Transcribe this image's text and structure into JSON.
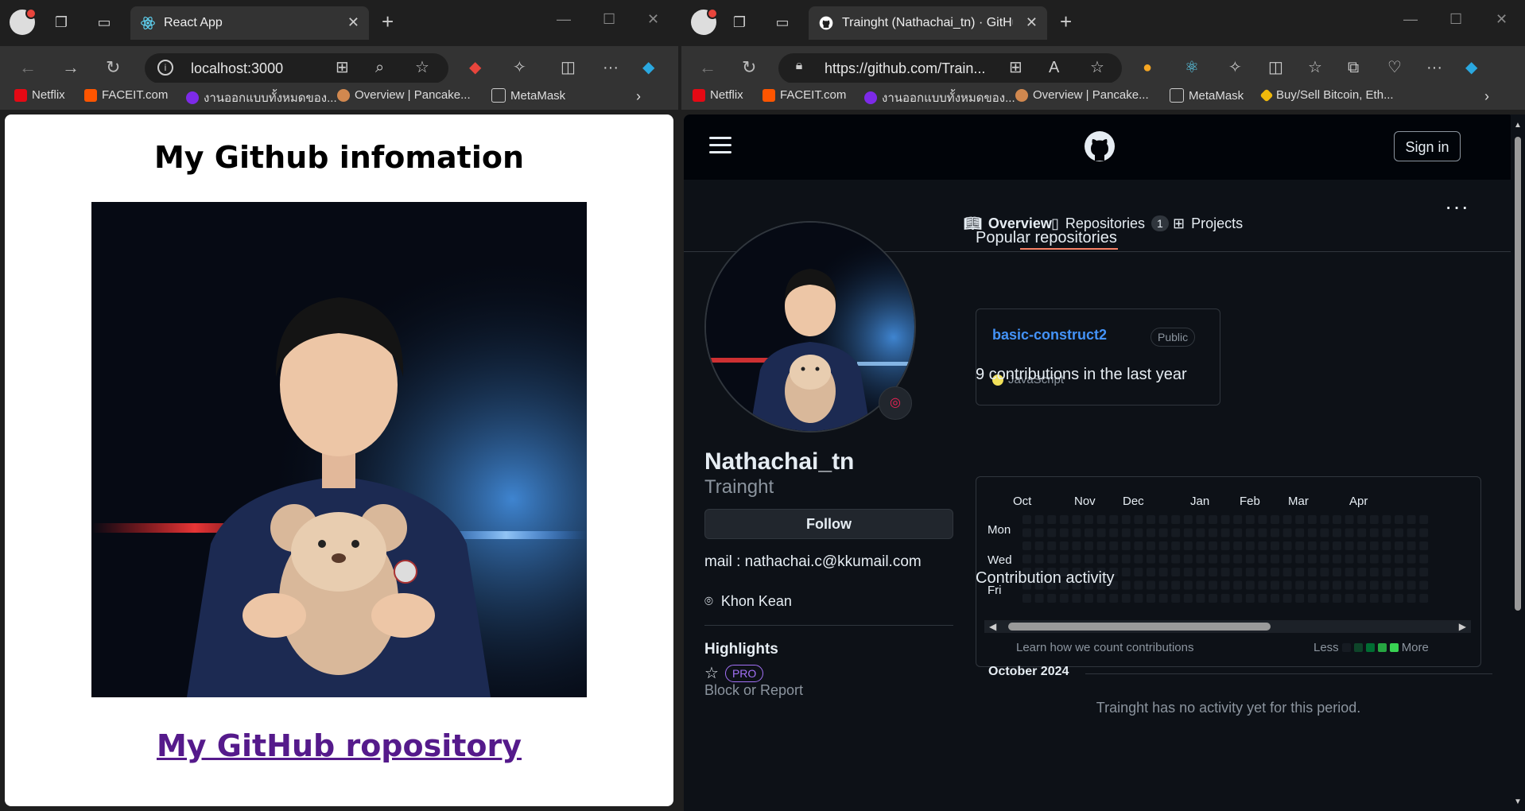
{
  "left_browser": {
    "tab_title": "React App",
    "address": "localhost:3000",
    "bookmarks": [
      "Netflix",
      "FACEIT.com",
      "งานออกแบบทั้งหมดของ...",
      "Overview | Pancake...",
      "MetaMask"
    ]
  },
  "left_page": {
    "title": "My Github infomation",
    "link_text": "My GitHub ropository"
  },
  "right_browser": {
    "tab_title": "Trainght (Nathachai_tn) · GitHub",
    "address": "https://github.com/Train...",
    "bookmarks": [
      "Netflix",
      "FACEIT.com",
      "งานออกแบบทั้งหมดของ...",
      "Overview | Pancake...",
      "MetaMask",
      "Buy/Sell Bitcoin, Eth..."
    ]
  },
  "github": {
    "sign_in": "Sign in",
    "tabs": [
      {
        "label": "Overview"
      },
      {
        "label": "Repositories",
        "count": "1"
      },
      {
        "label": "Projects"
      }
    ],
    "more": "···",
    "profile": {
      "name": "Nathachai_tn",
      "login": "Trainght",
      "follow": "Follow",
      "bio": "mail : nathachai.c@kkumail.com",
      "location": "Khon Kean",
      "highlights_title": "Highlights",
      "pro_badge": "PRO",
      "block_report": "Block or Report"
    },
    "popular": {
      "title": "Popular repositories",
      "repo_name": "basic-construct2",
      "visibility": "Public",
      "language": "JavaScript",
      "language_color": "#f1e05a"
    },
    "contributions": {
      "title": "9 contributions in the last year",
      "months": [
        "Oct",
        "Nov",
        "Dec",
        "Jan",
        "Feb",
        "Mar",
        "Apr"
      ],
      "days": [
        "Mon",
        "Wed",
        "Fri"
      ],
      "learn": "Learn how we count contributions",
      "less": "Less",
      "more": "More",
      "legend_colors": [
        "#161b22",
        "#0e4429",
        "#006d32",
        "#26a641",
        "#39d353"
      ]
    },
    "activity": {
      "title": "Contribution activity",
      "month": "October 2024",
      "empty": "Trainght has no activity yet for this period."
    }
  }
}
